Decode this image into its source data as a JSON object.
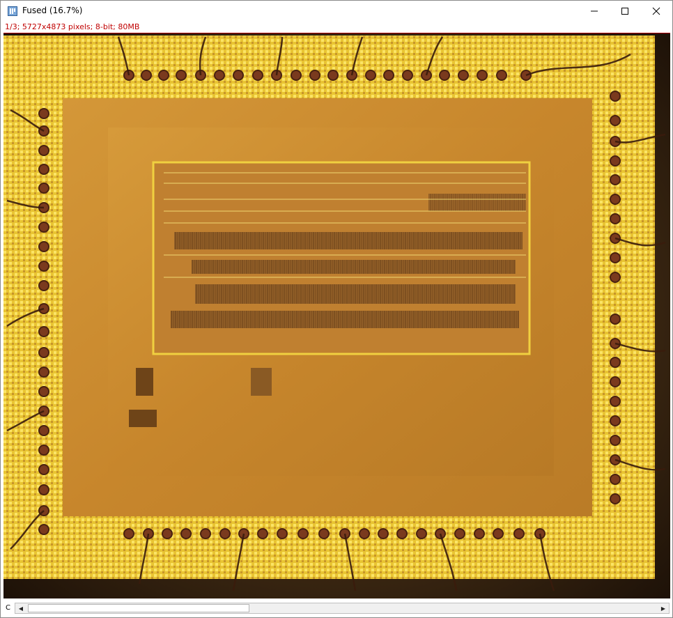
{
  "window": {
    "title": "Fused (16.7%)",
    "info_line": "1/3; 5727x4873 pixels; 8-bit; 80MB",
    "icons": {
      "app": "imagej-icon",
      "minimize": "minimize-icon",
      "maximize": "maximize-icon",
      "close": "close-icon"
    }
  },
  "image": {
    "description_name": "chip-die-micrograph",
    "palette": {
      "background": "#3a2410",
      "die": "#c98a2e",
      "metal": "#f2d23a",
      "bright": "#fff06a",
      "wire": "#4a2a14"
    }
  },
  "status": {
    "channel_label": "C"
  },
  "scrollbar": {
    "left_arrow": "◀",
    "right_arrow": "▶",
    "position_fraction": 0.02,
    "thumb_fraction": 0.34
  }
}
